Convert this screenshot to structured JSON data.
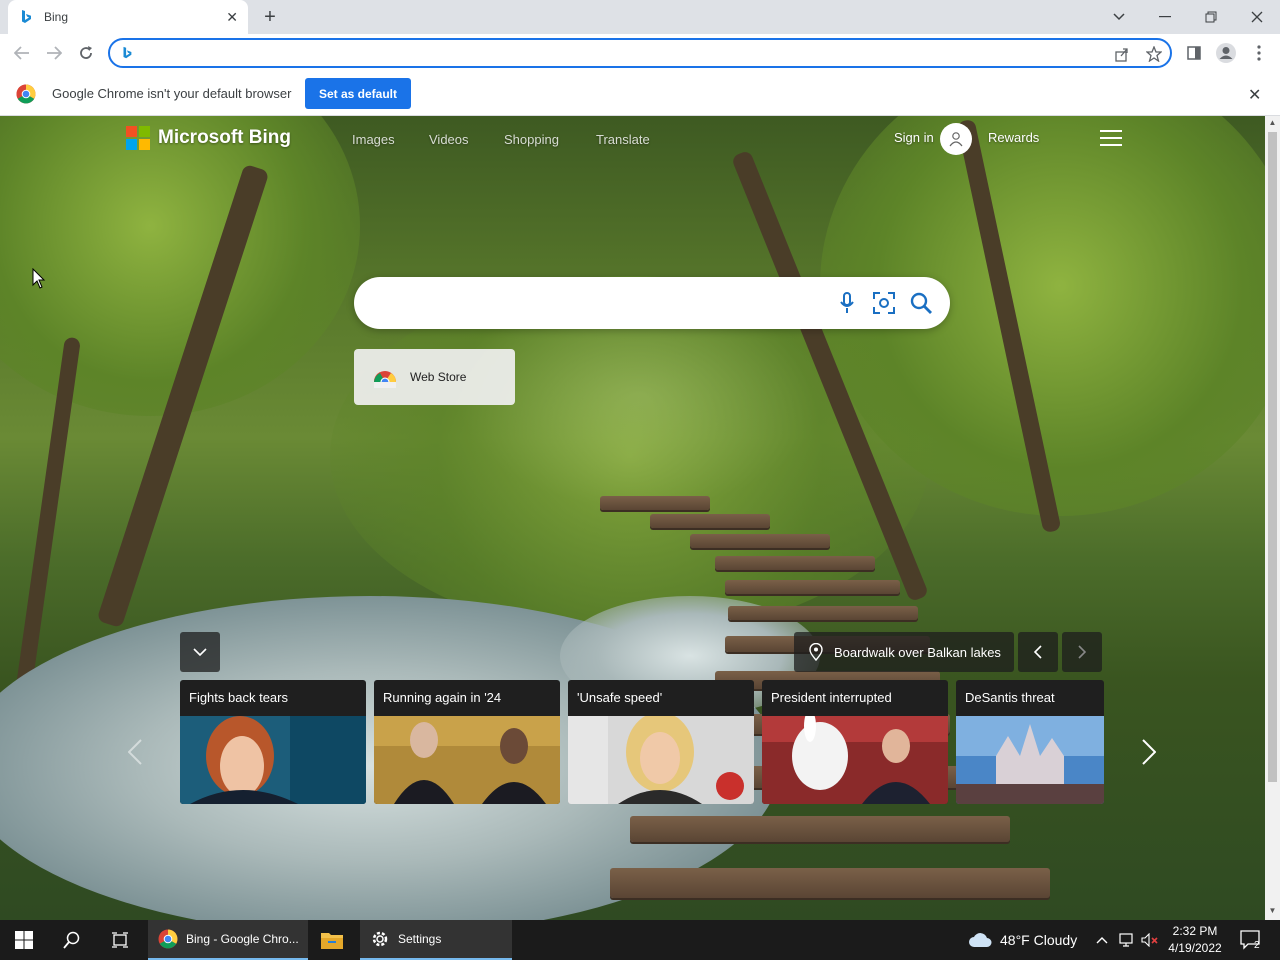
{
  "browser": {
    "tab": {
      "title": "Bing",
      "favicon": "bing-favicon"
    },
    "new_tab_icon": "plus-icon",
    "window_controls": [
      "tab-search-icon",
      "minimize-icon",
      "restore-icon",
      "close-icon"
    ],
    "address": {
      "value": "",
      "placeholder": ""
    },
    "toolbar_icons": [
      "share-icon",
      "bookmark-star-icon",
      "side-panel-icon",
      "profile-icon",
      "menu-kebab-icon"
    ]
  },
  "infobar": {
    "message": "Google Chrome isn't your default browser",
    "button": "Set as default"
  },
  "bing": {
    "brand": "Microsoft Bing",
    "nav": [
      "Images",
      "Videos",
      "Shopping",
      "Translate"
    ],
    "signin": "Sign in",
    "rewards": "Rewards",
    "search": {
      "value": "",
      "placeholder": ""
    },
    "search_icons": [
      "microphone-icon",
      "visual-search-icon",
      "search-icon"
    ],
    "tile": {
      "label": "Web Store"
    },
    "image_caption": "Boardwalk over Balkan lakes",
    "news": [
      {
        "headline": "Fights back tears"
      },
      {
        "headline": "Running again in '24"
      },
      {
        "headline": "'Unsafe speed'"
      },
      {
        "headline": "President interrupted"
      },
      {
        "headline": "DeSantis threat"
      }
    ]
  },
  "taskbar": {
    "chrome_label": "Bing - Google Chro...",
    "settings_label": "Settings",
    "weather": "48°F  Cloudy",
    "time": "2:32 PM",
    "date": "4/19/2022",
    "notification_count": "2"
  },
  "colors": {
    "accent": "#1a73e8",
    "ms_red": "#f25022",
    "ms_green": "#7fba00",
    "ms_blue": "#00a4ef",
    "ms_yellow": "#ffb900"
  }
}
